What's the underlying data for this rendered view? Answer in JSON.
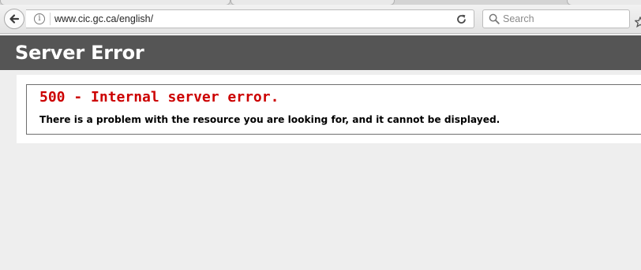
{
  "browser": {
    "url": "www.cic.gc.ca/english/",
    "search_placeholder": "Search"
  },
  "page": {
    "title": "Server Error",
    "error_heading": "500 - Internal server error.",
    "error_message": "There is a problem with the resource you are looking for, and it cannot be displayed."
  },
  "colors": {
    "header_bar": "#555555",
    "error_heading": "#cc0000",
    "page_background": "#eeeeee"
  },
  "icons": [
    "back-arrow-icon",
    "info-icon",
    "reload-icon",
    "search-icon",
    "bookmark-star-icon"
  ]
}
